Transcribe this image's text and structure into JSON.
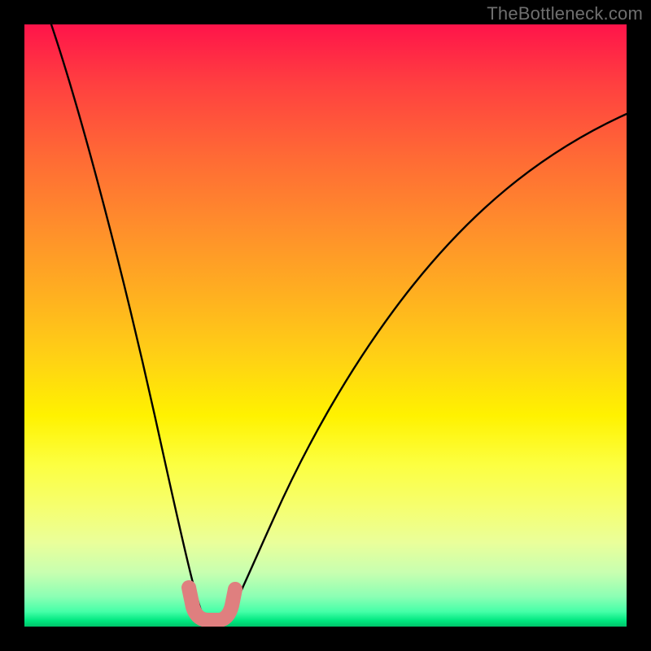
{
  "watermark": "TheBottleneck.com",
  "chart_data": {
    "type": "line",
    "title": "",
    "xlabel": "",
    "ylabel": "",
    "xlim": [
      0,
      100
    ],
    "ylim": [
      0,
      100
    ],
    "series": [
      {
        "name": "bottleneck-curve",
        "x": [
          0,
          5,
          10,
          15,
          18,
          21,
          24,
          26,
          28,
          29.5,
          31,
          33,
          35,
          38,
          42,
          48,
          55,
          63,
          72,
          82,
          92,
          100
        ],
        "y": [
          100,
          81,
          62,
          44,
          33,
          22,
          12,
          5,
          1,
          0,
          0,
          1.5,
          5,
          12,
          22,
          35,
          48,
          59,
          68,
          75,
          80,
          83
        ]
      }
    ],
    "annotations": [
      {
        "name": "highlight-trough",
        "shape": "u-mark",
        "x_range": [
          26,
          33
        ],
        "y_range": [
          0,
          6
        ],
        "color": "#e07878"
      }
    ],
    "gradient_stops": [
      {
        "pos": 0.0,
        "color": "#ff144a"
      },
      {
        "pos": 0.33,
        "color": "#ff8c2c"
      },
      {
        "pos": 0.65,
        "color": "#fff200"
      },
      {
        "pos": 0.95,
        "color": "#8cffb4"
      },
      {
        "pos": 1.0,
        "color": "#00c46a"
      }
    ]
  }
}
